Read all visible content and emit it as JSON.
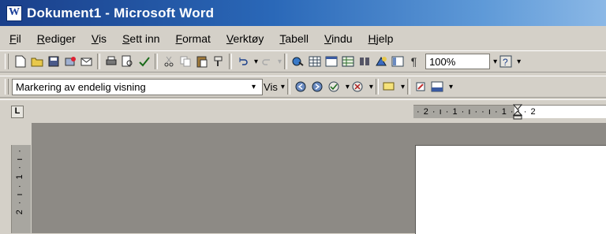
{
  "window": {
    "title": "Dokument1 - Microsoft Word",
    "app_icon": "word-icon"
  },
  "menu": {
    "items": [
      "Fil",
      "Rediger",
      "Vis",
      "Sett inn",
      "Format",
      "Verktøy",
      "Tabell",
      "Vindu",
      "Hjelp"
    ]
  },
  "standard_toolbar": {
    "zoom": "100%"
  },
  "review_toolbar": {
    "display_mode": "Markering av endelig visning",
    "show_label": "Vis"
  },
  "ruler": {
    "horizontal_text": "· 2 · ı · 1 · ı ·   · ı · 1 · ı · 2",
    "vertical_text": "2 · ı · 1 · ı ·",
    "tab_selector": "L"
  },
  "colors": {
    "titlebar_start": "#1a3f8a",
    "titlebar_end": "#8bb8e6",
    "chrome": "#d4d0c8",
    "workspace": "#8d8a85"
  }
}
